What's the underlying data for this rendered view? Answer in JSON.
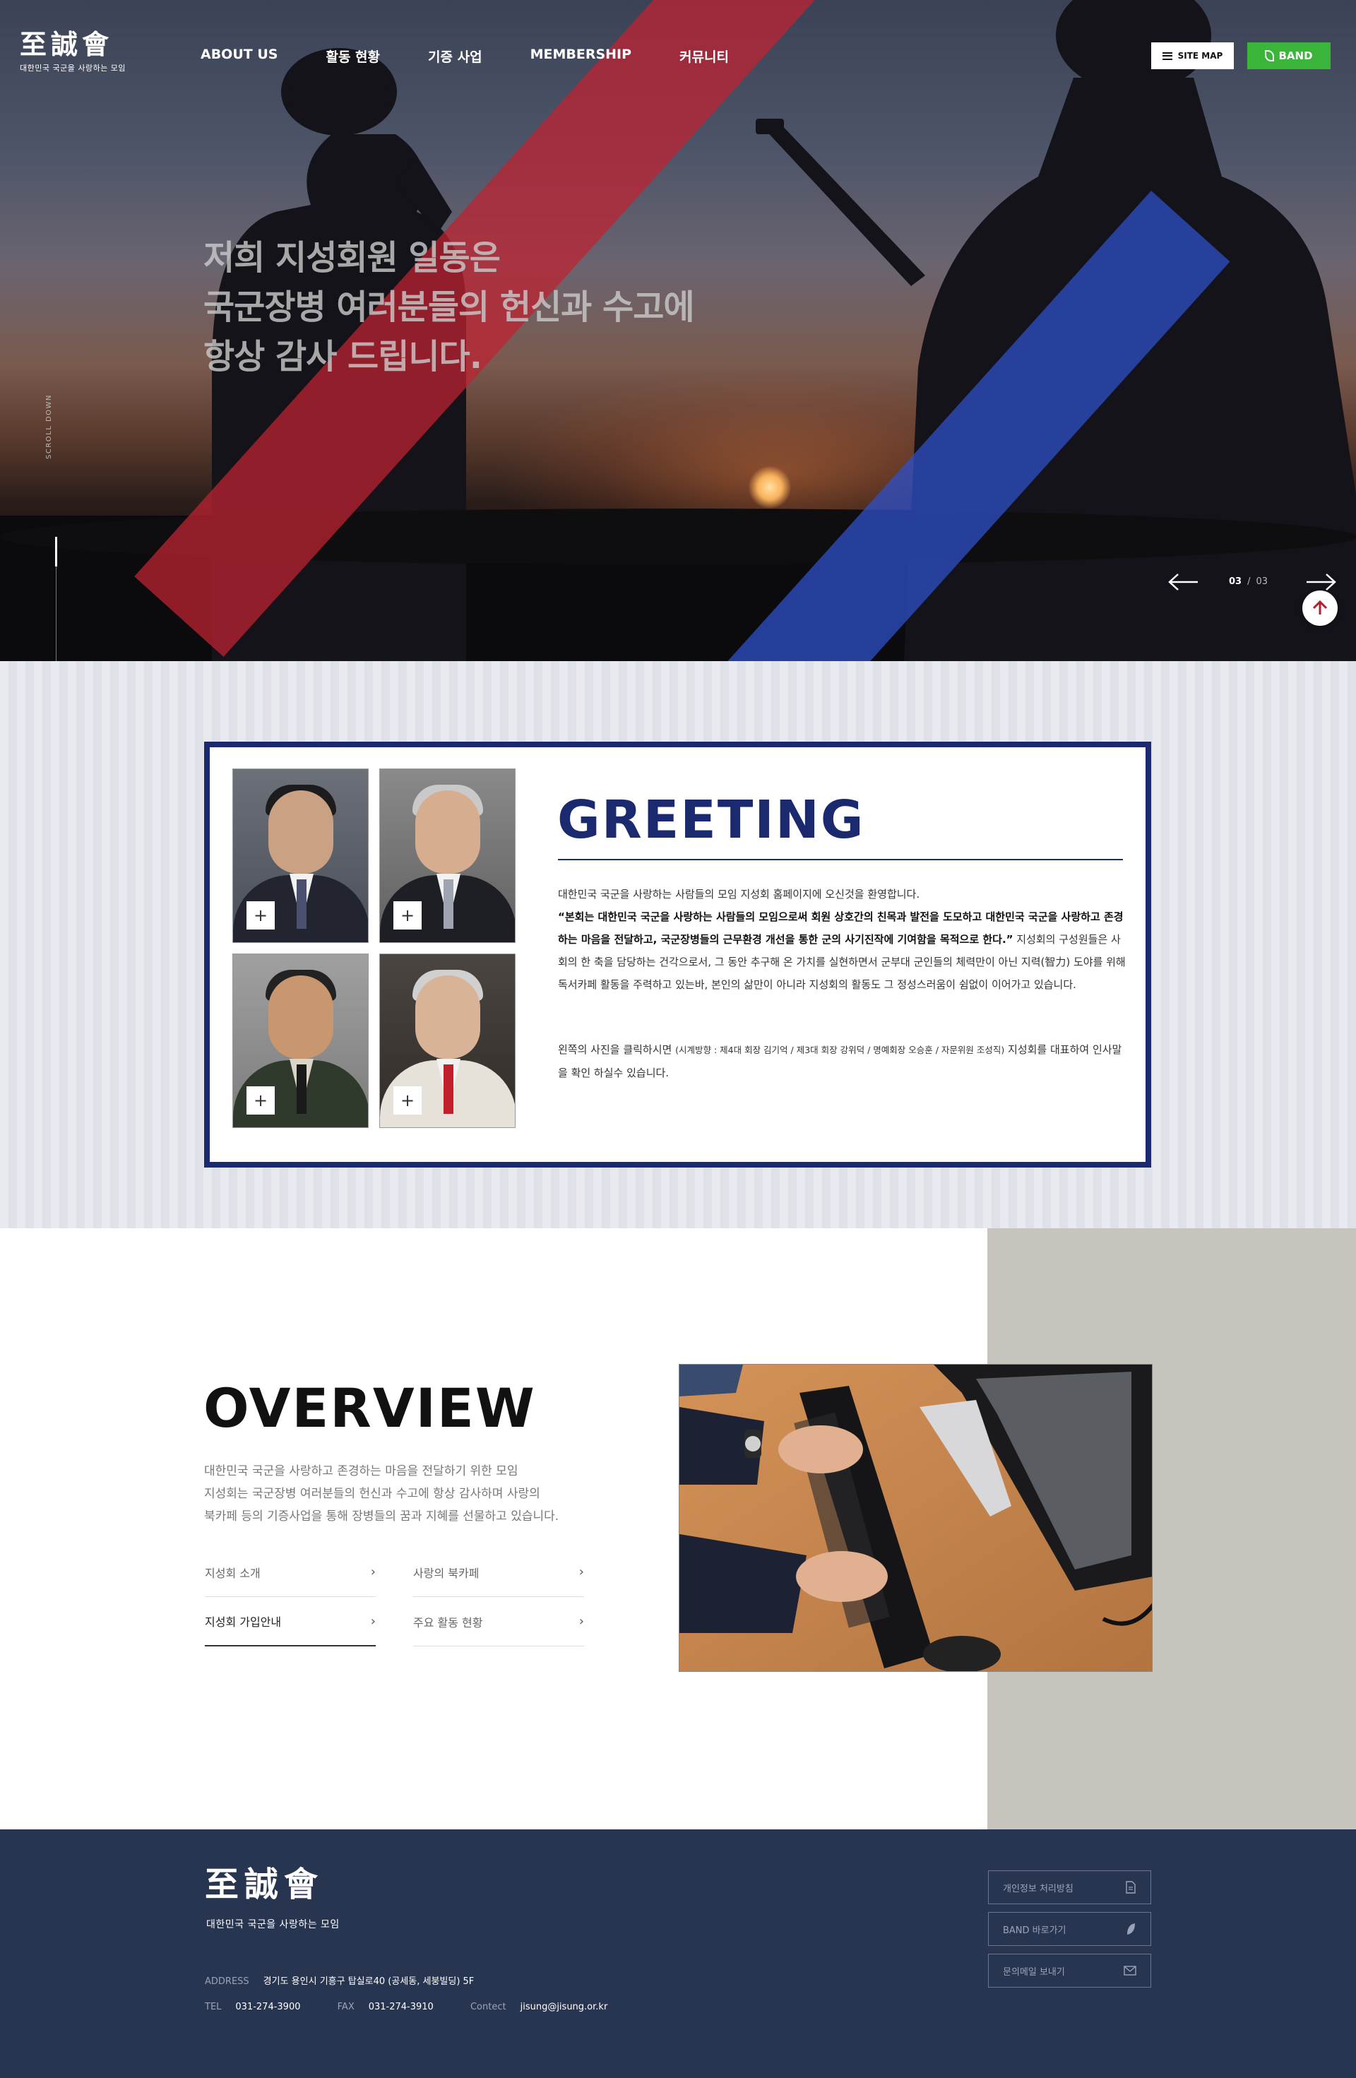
{
  "brand": {
    "logo_text": "至誠會",
    "tagline": "대한민국 국군을 사랑하는 모임"
  },
  "nav": {
    "items": [
      {
        "label": "ABOUT US"
      },
      {
        "label": "활동 현황"
      },
      {
        "label": "기증 사업"
      },
      {
        "label": "MEMBERSHIP"
      },
      {
        "label": "커뮤니티"
      }
    ]
  },
  "header_buttons": {
    "sitemap": "SITE MAP",
    "band": "BAND"
  },
  "hero": {
    "lines": [
      "저희 지성회원 일동은",
      "국군장병 여러분들의 헌신과 수고에",
      "항상 감사 드립니다."
    ],
    "scroll_label": "SCROLL DOWN",
    "slide_current": "03",
    "slide_separator": "/",
    "slide_total": "03",
    "colors": {
      "stripe_red": "#be2332",
      "stripe_blue": "#2d50c8"
    }
  },
  "greeting": {
    "title": "GREETING",
    "intro": "대한민국 국군을 사랑하는 사람들의 모임 지성회 홈페이지에 오신것을 환영합니다.",
    "bold_quote": "“본회는 대한민국 국군을 사랑하는 사람들의 모임으로써 회원 상호간의 친목과 발전을 도모하고 대한민국 국군을 사랑하고 존경하는 마음을 전달하고, 국군장병들의 근무환경 개선을 통한 군의 사기진작에 기여함을 목적으로 한다.”",
    "body": " 지성회의 구성원들은 사회의 한 축을 담당하는 건각으로서, 그 동안 추구해 온 가치를 실현하면서 군부대 군인들의 체력만이 아닌 지력(智力) 도야를 위해 독서카페 활동을 주력하고 있는바, 본인의 삶만이 아니라 지성회의 활동도 그 정성스러움이 쉼없이 이어가고 있습니다.",
    "photo_hint_a": "왼쪽의 사진을 클릭하시면 ",
    "photo_hint_small": "(시계방향 : 제4대 회장 김기억 / 제3대 회장 강위덕 / 명예회장 오승훈 / 자문위원 조성직)",
    "photo_hint_b": " 지성회를 대표하여 인사말을 확인 하실수 있습니다.",
    "plus_symbol": "+",
    "accent_color": "#1b2a6f"
  },
  "overview": {
    "title": "OVERVIEW",
    "desc": [
      "대한민국 국군을 사랑하고 존경하는 마음을 전달하기 위한 모임",
      "지성회는 국군장병 여러분들의 헌신과 수고에 항상 감사하며 사랑의",
      "북카페 등의 기증사업을 통해 장병들의 꿈과 지혜를 선물하고 있습니다."
    ],
    "links": [
      {
        "label": "지성회 소개"
      },
      {
        "label": "사랑의 북카페"
      },
      {
        "label": "지성회 가입안내"
      },
      {
        "label": "주요 활동 현황"
      }
    ],
    "chevron": "›"
  },
  "footer": {
    "logo_text": "至誠會",
    "tagline": "대한민국 국군을 사랑하는 모임",
    "address_label": "ADDRESS",
    "address": "경기도 용인시 기흥구 탑실로40 (공세동, 세붕빌딩) 5F",
    "tel_label": "TEL",
    "tel": "031-274-3900",
    "fax_label": "FAX",
    "fax": "031-274-3910",
    "contact_label": "Contect",
    "contact": "jisung@jisung.or.kr",
    "buttons": [
      {
        "label": "개인정보 처리방침",
        "icon": "document-icon"
      },
      {
        "label": "BAND 바로가기",
        "icon": "band-leaf-icon"
      },
      {
        "label": "문의메일 보내기",
        "icon": "mail-icon"
      }
    ]
  }
}
